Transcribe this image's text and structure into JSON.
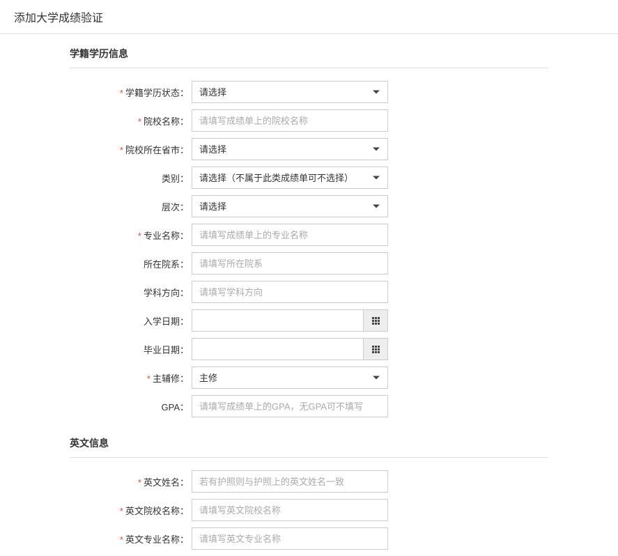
{
  "page": {
    "title": "添加大学成绩验证"
  },
  "section1": {
    "title": "学籍学历信息",
    "fields": {
      "status": {
        "label": "学籍学历状态：",
        "placeholder": "请选择"
      },
      "school": {
        "label": "院校名称：",
        "placeholder": "请填写成绩单上的院校名称"
      },
      "province": {
        "label": "院校所在省市：",
        "placeholder": "请选择"
      },
      "category": {
        "label": "类别：",
        "placeholder": "请选择（不属于此类成绩单可不选择）"
      },
      "level": {
        "label": "层次：",
        "placeholder": "请选择"
      },
      "major": {
        "label": "专业名称：",
        "placeholder": "请填写成绩单上的专业名称"
      },
      "department": {
        "label": "所在院系：",
        "placeholder": "请填写所在院系"
      },
      "direction": {
        "label": "学科方向：",
        "placeholder": "请填写学科方向"
      },
      "enrollDate": {
        "label": "入学日期："
      },
      "gradDate": {
        "label": "毕业日期："
      },
      "majorMinor": {
        "label": "主辅修：",
        "value": "主修"
      },
      "gpa": {
        "label": "GPA：",
        "placeholder": "请填写成绩单上的GPA，无GPA可不填写"
      }
    }
  },
  "section2": {
    "title": "英文信息",
    "fields": {
      "enName": {
        "label": "英文姓名：",
        "placeholder": "若有护照则与护照上的英文姓名一致"
      },
      "enSchool": {
        "label": "英文院校名称：",
        "placeholder": "请填写英文院校名称"
      },
      "enMajor": {
        "label": "英文专业名称：",
        "placeholder": "请填写英文专业名称"
      }
    }
  }
}
